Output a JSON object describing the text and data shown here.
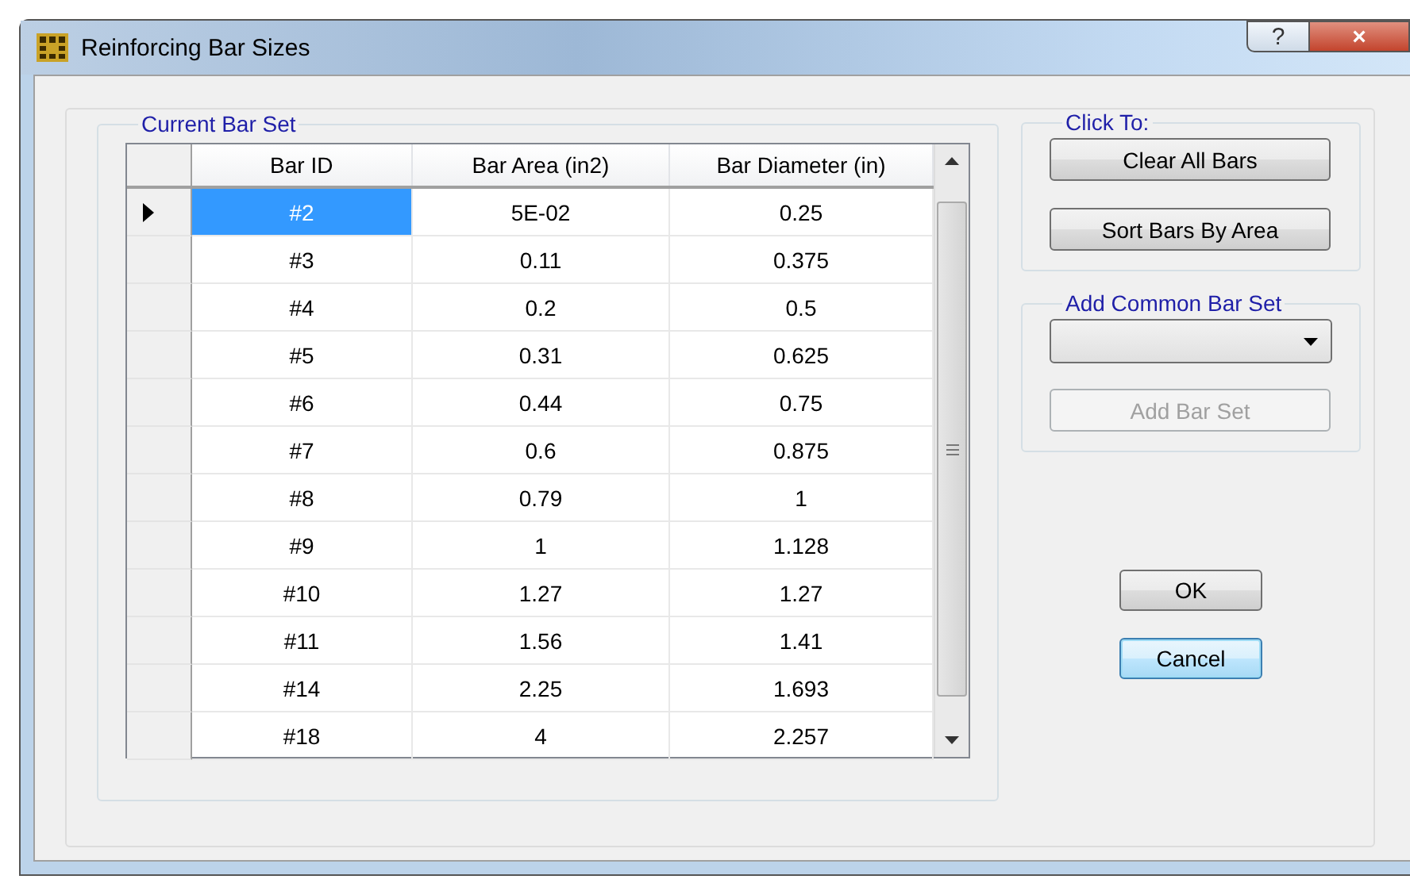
{
  "window": {
    "title": "Reinforcing Bar Sizes",
    "help_button": "?",
    "close_button": "×"
  },
  "bar_set": {
    "title": "Current Bar Set",
    "columns": [
      "Bar ID",
      "Bar Area  (in2)",
      "Bar Diameter  (in)"
    ],
    "rows": [
      {
        "cells": [
          "#2",
          "5E-02",
          "0.25"
        ],
        "selected": true
      },
      {
        "cells": [
          "#3",
          "0.11",
          "0.375"
        ],
        "selected": false
      },
      {
        "cells": [
          "#4",
          "0.2",
          "0.5"
        ],
        "selected": false
      },
      {
        "cells": [
          "#5",
          "0.31",
          "0.625"
        ],
        "selected": false
      },
      {
        "cells": [
          "#6",
          "0.44",
          "0.75"
        ],
        "selected": false
      },
      {
        "cells": [
          "#7",
          "0.6",
          "0.875"
        ],
        "selected": false
      },
      {
        "cells": [
          "#8",
          "0.79",
          "1"
        ],
        "selected": false
      },
      {
        "cells": [
          "#9",
          "1",
          "1.128"
        ],
        "selected": false
      },
      {
        "cells": [
          "#10",
          "1.27",
          "1.27"
        ],
        "selected": false
      },
      {
        "cells": [
          "#11",
          "1.56",
          "1.41"
        ],
        "selected": false
      },
      {
        "cells": [
          "#14",
          "2.25",
          "1.693"
        ],
        "selected": false
      },
      {
        "cells": [
          "#18",
          "4",
          "2.257"
        ],
        "selected": false
      }
    ]
  },
  "click_to": {
    "title": "Click To:",
    "buttons": [
      {
        "label": "Clear All Bars",
        "disabled": false
      },
      {
        "label": "Sort Bars By Area",
        "disabled": false
      }
    ]
  },
  "add_common_bar_set": {
    "title": "Add Common Bar Set",
    "button": {
      "label": "Add Bar Set",
      "disabled": true
    }
  },
  "dialog_buttons": [
    {
      "label": "OK",
      "focused": false
    },
    {
      "label": "Cancel",
      "focused": true
    }
  ]
}
